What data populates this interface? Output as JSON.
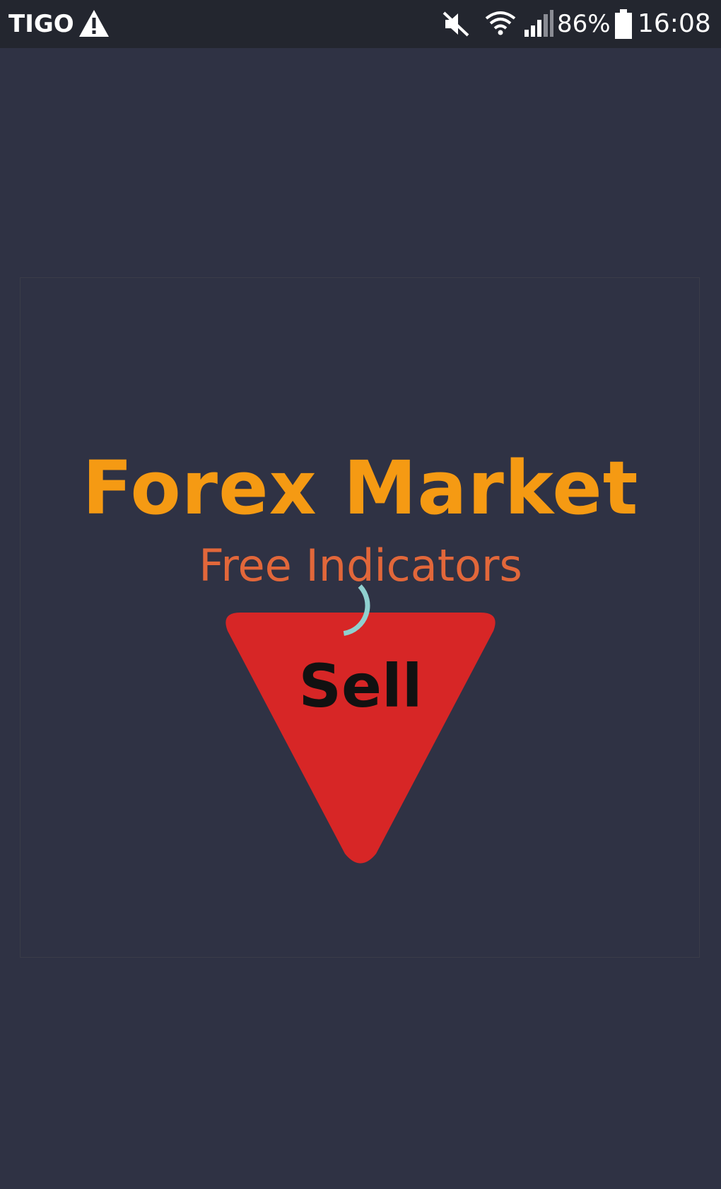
{
  "status_bar": {
    "carrier": "TIGO",
    "battery_percent": "86%",
    "time": "16:08",
    "icons": [
      "warning-icon",
      "mute-icon",
      "wifi-icon",
      "signal-icon",
      "battery-icon"
    ]
  },
  "splash": {
    "title": "Forex Market",
    "subtitle": "Free Indicators",
    "sell_label": "Sell",
    "colors": {
      "background": "#2f3244",
      "title": "#f59a13",
      "subtitle": "#e2673a",
      "triangle": "#d72626",
      "spinner": "#8fd0cf"
    }
  }
}
